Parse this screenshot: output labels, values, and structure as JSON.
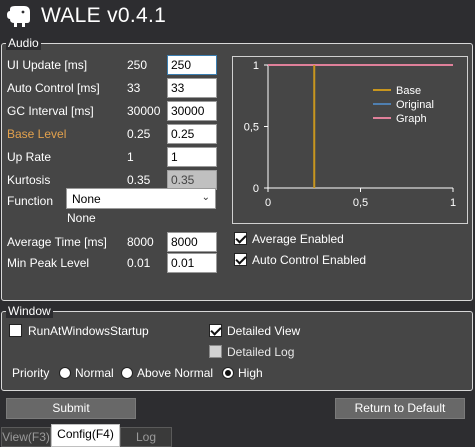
{
  "app": {
    "title": "WALE v0.4.1",
    "icon": "elephant-icon"
  },
  "audio": {
    "group_title": "Audio",
    "fields": [
      {
        "label": "UI Update [ms]",
        "current": "250",
        "input": "250"
      },
      {
        "label": "Auto Control [ms]",
        "current": "33",
        "input": "33"
      },
      {
        "label": "GC Interval [ms]",
        "current": "30000",
        "input": "30000"
      },
      {
        "label": "Base Level",
        "current": "0.25",
        "input": "0.25"
      },
      {
        "label": "Up Rate",
        "current": "1",
        "input": "1"
      },
      {
        "label": "Kurtosis",
        "current": "0.35",
        "input": "0.35"
      }
    ],
    "function": {
      "label": "Function",
      "selected": "None",
      "current": "None"
    },
    "average_time": {
      "label": "Average Time [ms]",
      "current": "8000",
      "input": "8000"
    },
    "min_peak": {
      "label": "Min Peak Level",
      "current": "0.01",
      "input": "0.01"
    },
    "average_enabled": {
      "label": "Average Enabled",
      "checked": true
    },
    "auto_control_enabled": {
      "label": "Auto Control Enabled",
      "checked": true
    }
  },
  "window": {
    "group_title": "Window",
    "run_at_startup": {
      "label": "RunAtWindowsStartup",
      "checked": false
    },
    "detailed_view": {
      "label": "Detailed View",
      "checked": true
    },
    "detailed_log": {
      "label": "Detailed Log",
      "checked": false
    },
    "priority": {
      "label": "Priority",
      "options": [
        "Normal",
        "Above Normal",
        "High"
      ],
      "selected": "High"
    }
  },
  "buttons": {
    "submit": "Submit",
    "return_default": "Return to Default"
  },
  "tabs": [
    {
      "label": "View(F3)",
      "active": false
    },
    {
      "label": "Config(F4)",
      "active": true
    },
    {
      "label": "Log",
      "active": false
    }
  ],
  "colors": {
    "base": "#c8961e",
    "original": "#4f7fb0",
    "graph": "#e0809a",
    "label_highlight": "#e2a14d"
  },
  "chart_data": {
    "type": "line",
    "xlim": [
      0,
      1
    ],
    "ylim": [
      0,
      1
    ],
    "x_ticks": [
      "0",
      "0,5",
      "1"
    ],
    "y_ticks": [
      "0",
      "0,5",
      "1"
    ],
    "grid": false,
    "legend_position": "top-right",
    "series": [
      {
        "name": "Base",
        "x": [
          0.25,
          0.25
        ],
        "y": [
          0,
          1
        ],
        "color": "#c8961e"
      },
      {
        "name": "Original",
        "x": [
          0,
          1
        ],
        "y": [
          1,
          1
        ],
        "color": "#4f7fb0"
      },
      {
        "name": "Graph",
        "x": [
          0,
          1
        ],
        "y": [
          1,
          1
        ],
        "color": "#e0809a"
      }
    ]
  }
}
